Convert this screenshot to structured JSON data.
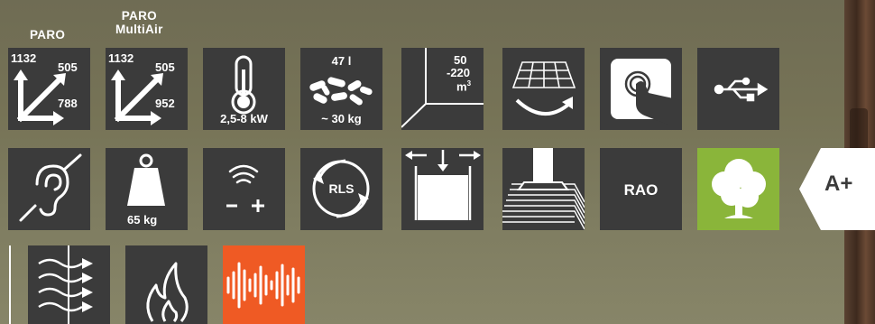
{
  "headers": {
    "paro": "PARO",
    "paro_multiair_line1": "PARO",
    "paro_multiair_line2": "MultiAir"
  },
  "dimensions_paro": {
    "height": "1132",
    "width": "505",
    "depth": "788"
  },
  "dimensions_multiair": {
    "height": "1132",
    "width": "505",
    "depth": "952"
  },
  "power": {
    "range": "2,5-8 kW"
  },
  "pellets": {
    "volume": "47 l",
    "weight": "~ 30 kg"
  },
  "room_size": {
    "line1": "50",
    "line2": "-220",
    "unit": "m",
    "unit_sup": "3"
  },
  "weight": {
    "value": "65 kg"
  },
  "rls": {
    "label": "RLS"
  },
  "rao": {
    "label": "RAO"
  },
  "energy_class": {
    "label": "A+"
  },
  "colors": {
    "tile": "#3b3b3b",
    "green": "#8ab53a",
    "orange": "#ef5a24"
  }
}
